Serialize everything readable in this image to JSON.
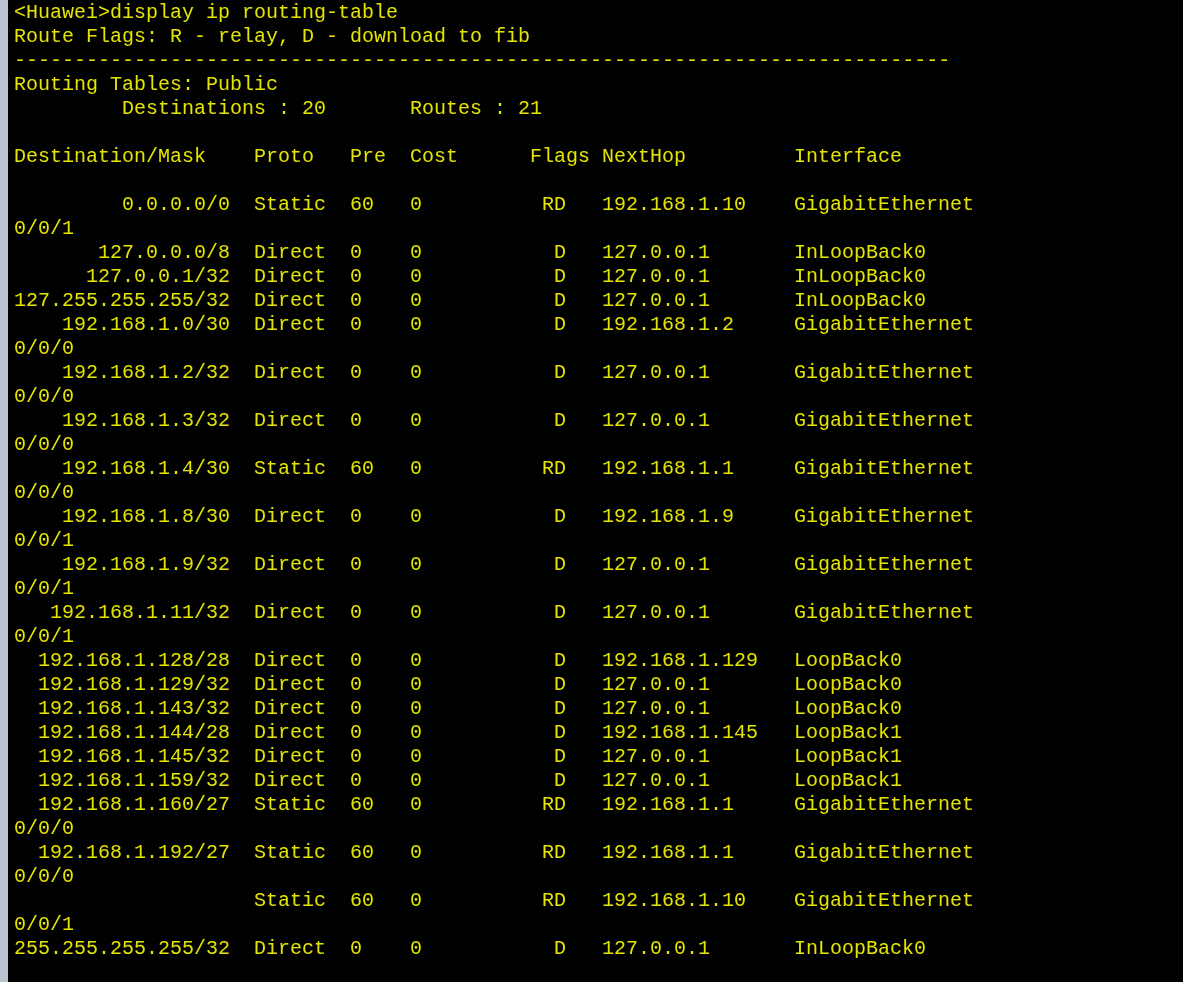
{
  "command": "<Huawei>display ip routing-table",
  "legend": "Route Flags: R - relay, D - download to fib",
  "separator": "------------------------------------------------------------------------------",
  "table_title": "Routing Tables: Public",
  "summary": {
    "destinations": "Destinations : 20",
    "routes": "Routes : 21"
  },
  "columns": [
    "Destination/Mask",
    "Proto",
    "Pre",
    "Cost",
    "Flags",
    "NextHop",
    "Interface"
  ],
  "rows": [
    {
      "destination": "0.0.0.0/0",
      "proto": "Static",
      "pre": "60",
      "cost": "0",
      "flags": "RD",
      "nexthop": "192.168.1.10",
      "interface": "GigabitEthernet",
      "interface_wrap": "0/0/1"
    },
    {
      "destination": "127.0.0.0/8",
      "proto": "Direct",
      "pre": "0",
      "cost": "0",
      "flags": "D",
      "nexthop": "127.0.0.1",
      "interface": "InLoopBack0"
    },
    {
      "destination": "127.0.0.1/32",
      "proto": "Direct",
      "pre": "0",
      "cost": "0",
      "flags": "D",
      "nexthop": "127.0.0.1",
      "interface": "InLoopBack0"
    },
    {
      "destination": "127.255.255.255/32",
      "proto": "Direct",
      "pre": "0",
      "cost": "0",
      "flags": "D",
      "nexthop": "127.0.0.1",
      "interface": "InLoopBack0"
    },
    {
      "destination": "192.168.1.0/30",
      "proto": "Direct",
      "pre": "0",
      "cost": "0",
      "flags": "D",
      "nexthop": "192.168.1.2",
      "interface": "GigabitEthernet",
      "interface_wrap": "0/0/0"
    },
    {
      "destination": "192.168.1.2/32",
      "proto": "Direct",
      "pre": "0",
      "cost": "0",
      "flags": "D",
      "nexthop": "127.0.0.1",
      "interface": "GigabitEthernet",
      "interface_wrap": "0/0/0"
    },
    {
      "destination": "192.168.1.3/32",
      "proto": "Direct",
      "pre": "0",
      "cost": "0",
      "flags": "D",
      "nexthop": "127.0.0.1",
      "interface": "GigabitEthernet",
      "interface_wrap": "0/0/0"
    },
    {
      "destination": "192.168.1.4/30",
      "proto": "Static",
      "pre": "60",
      "cost": "0",
      "flags": "RD",
      "nexthop": "192.168.1.1",
      "interface": "GigabitEthernet",
      "interface_wrap": "0/0/0"
    },
    {
      "destination": "192.168.1.8/30",
      "proto": "Direct",
      "pre": "0",
      "cost": "0",
      "flags": "D",
      "nexthop": "192.168.1.9",
      "interface": "GigabitEthernet",
      "interface_wrap": "0/0/1"
    },
    {
      "destination": "192.168.1.9/32",
      "proto": "Direct",
      "pre": "0",
      "cost": "0",
      "flags": "D",
      "nexthop": "127.0.0.1",
      "interface": "GigabitEthernet",
      "interface_wrap": "0/0/1"
    },
    {
      "destination": "192.168.1.11/32",
      "proto": "Direct",
      "pre": "0",
      "cost": "0",
      "flags": "D",
      "nexthop": "127.0.0.1",
      "interface": "GigabitEthernet",
      "interface_wrap": "0/0/1"
    },
    {
      "destination": "192.168.1.128/28",
      "proto": "Direct",
      "pre": "0",
      "cost": "0",
      "flags": "D",
      "nexthop": "192.168.1.129",
      "interface": "LoopBack0"
    },
    {
      "destination": "192.168.1.129/32",
      "proto": "Direct",
      "pre": "0",
      "cost": "0",
      "flags": "D",
      "nexthop": "127.0.0.1",
      "interface": "LoopBack0"
    },
    {
      "destination": "192.168.1.143/32",
      "proto": "Direct",
      "pre": "0",
      "cost": "0",
      "flags": "D",
      "nexthop": "127.0.0.1",
      "interface": "LoopBack0"
    },
    {
      "destination": "192.168.1.144/28",
      "proto": "Direct",
      "pre": "0",
      "cost": "0",
      "flags": "D",
      "nexthop": "192.168.1.145",
      "interface": "LoopBack1"
    },
    {
      "destination": "192.168.1.145/32",
      "proto": "Direct",
      "pre": "0",
      "cost": "0",
      "flags": "D",
      "nexthop": "127.0.0.1",
      "interface": "LoopBack1"
    },
    {
      "destination": "192.168.1.159/32",
      "proto": "Direct",
      "pre": "0",
      "cost": "0",
      "flags": "D",
      "nexthop": "127.0.0.1",
      "interface": "LoopBack1"
    },
    {
      "destination": "192.168.1.160/27",
      "proto": "Static",
      "pre": "60",
      "cost": "0",
      "flags": "RD",
      "nexthop": "192.168.1.1",
      "interface": "GigabitEthernet",
      "interface_wrap": "0/0/0"
    },
    {
      "destination": "192.168.1.192/27",
      "proto": "Static",
      "pre": "60",
      "cost": "0",
      "flags": "RD",
      "nexthop": "192.168.1.1",
      "interface": "GigabitEthernet",
      "interface_wrap": "0/0/0"
    },
    {
      "proto": "Static",
      "pre": "60",
      "cost": "0",
      "flags": "RD",
      "nexthop": "192.168.1.10",
      "interface": "GigabitEthernet",
      "interface_wrap": "0/0/1"
    },
    {
      "destination": "255.255.255.255/32",
      "proto": "Direct",
      "pre": "0",
      "cost": "0",
      "flags": "D",
      "nexthop": "127.0.0.1",
      "interface": "InLoopBack0"
    }
  ]
}
